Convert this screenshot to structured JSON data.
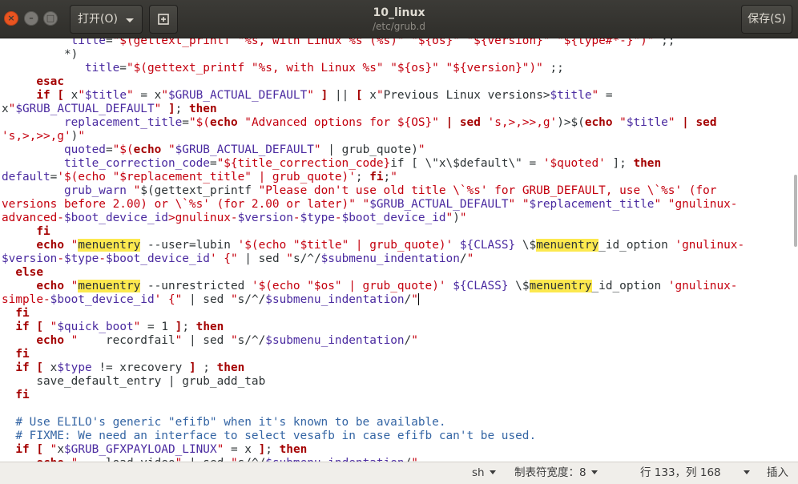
{
  "window": {
    "title": "10_linux",
    "subtitle": "/etc/grub.d",
    "open_label": "打开(O)",
    "save_label": "保存(S)",
    "new_tab_icon": "new-tab-icon",
    "close_symbol": "×",
    "minimize_symbol": "–",
    "maximize_symbol": "□"
  },
  "editor": {
    "highlight_term": "menuentry"
  },
  "status": {
    "language": "sh",
    "tab_width": "制表符宽度：8",
    "position": "行 133，列 168",
    "mode": "插入"
  },
  "colors": {
    "titlebar": "#3c3b37",
    "close_button": "#e95420",
    "keyword": "#a40000",
    "string": "#c4000e",
    "variable": "#4a2aa0",
    "comment": "#3465a4",
    "search_highlight": "#fce94f"
  }
}
